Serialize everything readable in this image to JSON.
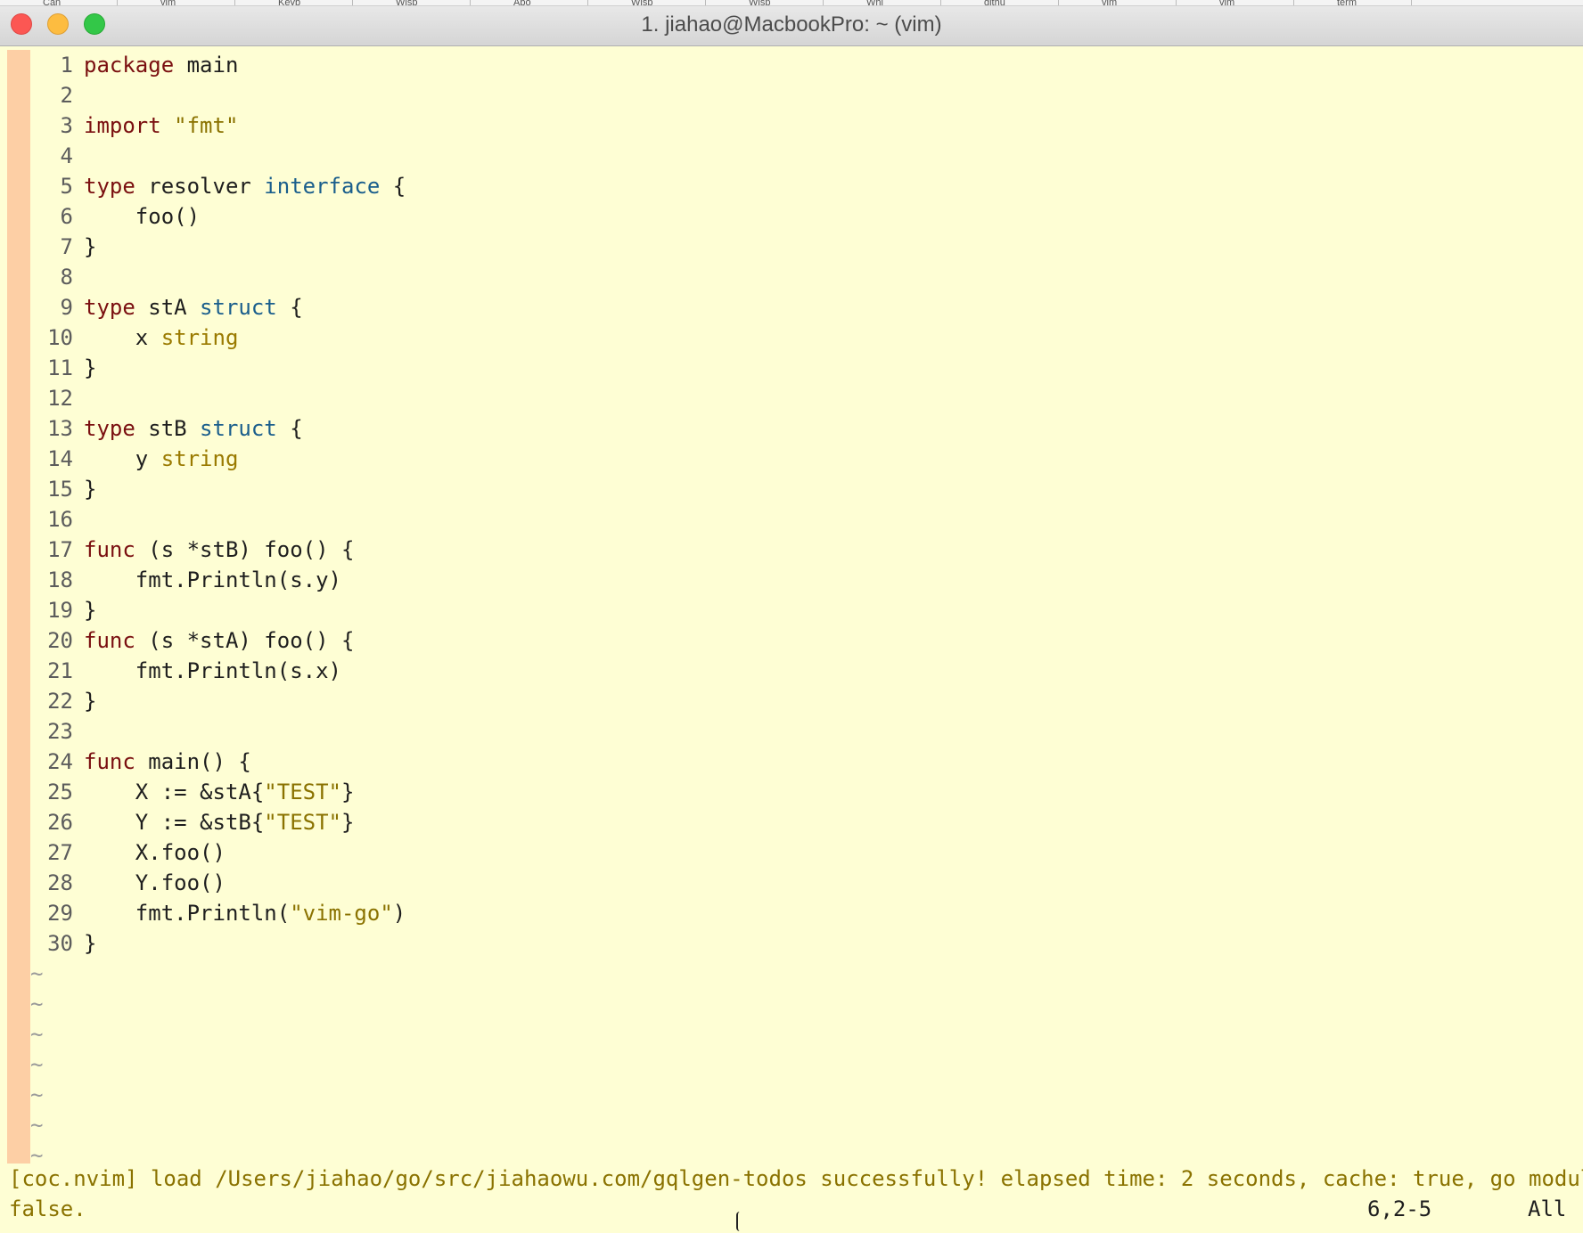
{
  "window": {
    "title": "1. jiahao@MacbookPro: ~ (vim)",
    "tabs": [
      "Can",
      "vim",
      "Keyb",
      "Wisp",
      "Abo",
      "Wisp",
      "Wisp",
      "Whi",
      "githu",
      "vim",
      "vim",
      "term"
    ]
  },
  "editor": {
    "lines": [
      {
        "n": "1",
        "text": "package main"
      },
      {
        "n": "2",
        "text": ""
      },
      {
        "n": "3",
        "text": "import \"fmt\""
      },
      {
        "n": "4",
        "text": ""
      },
      {
        "n": "5",
        "text": "type resolver interface {"
      },
      {
        "n": "6",
        "text": "    foo()"
      },
      {
        "n": "7",
        "text": "}"
      },
      {
        "n": "8",
        "text": ""
      },
      {
        "n": "9",
        "text": "type stA struct {"
      },
      {
        "n": "10",
        "text": "    x string"
      },
      {
        "n": "11",
        "text": "}"
      },
      {
        "n": "12",
        "text": ""
      },
      {
        "n": "13",
        "text": "type stB struct {"
      },
      {
        "n": "14",
        "text": "    y string"
      },
      {
        "n": "15",
        "text": "}"
      },
      {
        "n": "16",
        "text": ""
      },
      {
        "n": "17",
        "text": "func (s *stB) foo() {"
      },
      {
        "n": "18",
        "text": "    fmt.Println(s.y)"
      },
      {
        "n": "19",
        "text": "}"
      },
      {
        "n": "20",
        "text": "func (s *stA) foo() {"
      },
      {
        "n": "21",
        "text": "    fmt.Println(s.x)"
      },
      {
        "n": "22",
        "text": "}"
      },
      {
        "n": "23",
        "text": ""
      },
      {
        "n": "24",
        "text": "func main() {"
      },
      {
        "n": "25",
        "text": "    X := &stA{\"TEST\"}"
      },
      {
        "n": "26",
        "text": "    Y := &stB{\"TEST\"}"
      },
      {
        "n": "27",
        "text": "    X.foo()"
      },
      {
        "n": "28",
        "text": "    Y.foo()"
      },
      {
        "n": "29",
        "text": "    fmt.Println(\"vim-go\")"
      },
      {
        "n": "30",
        "text": "}"
      }
    ],
    "empty_marker": "~",
    "empty_rows": 7
  },
  "status": {
    "message_line1": "[coc.nvim] load /Users/jiahao/go/src/jiahaowu.com/gqlgen-todos successfully! elapsed time: 2 seconds, cache: true, go module:",
    "message_line2": "false.",
    "cursor_position": "6,2-5",
    "scroll_position": "All"
  },
  "colors": {
    "background": "#fefed4",
    "sign_column": "#fdcfa5",
    "keyword": "#7a0f10",
    "type": "#1a5e8c",
    "string": "#8a7200",
    "message": "#8a7200"
  }
}
